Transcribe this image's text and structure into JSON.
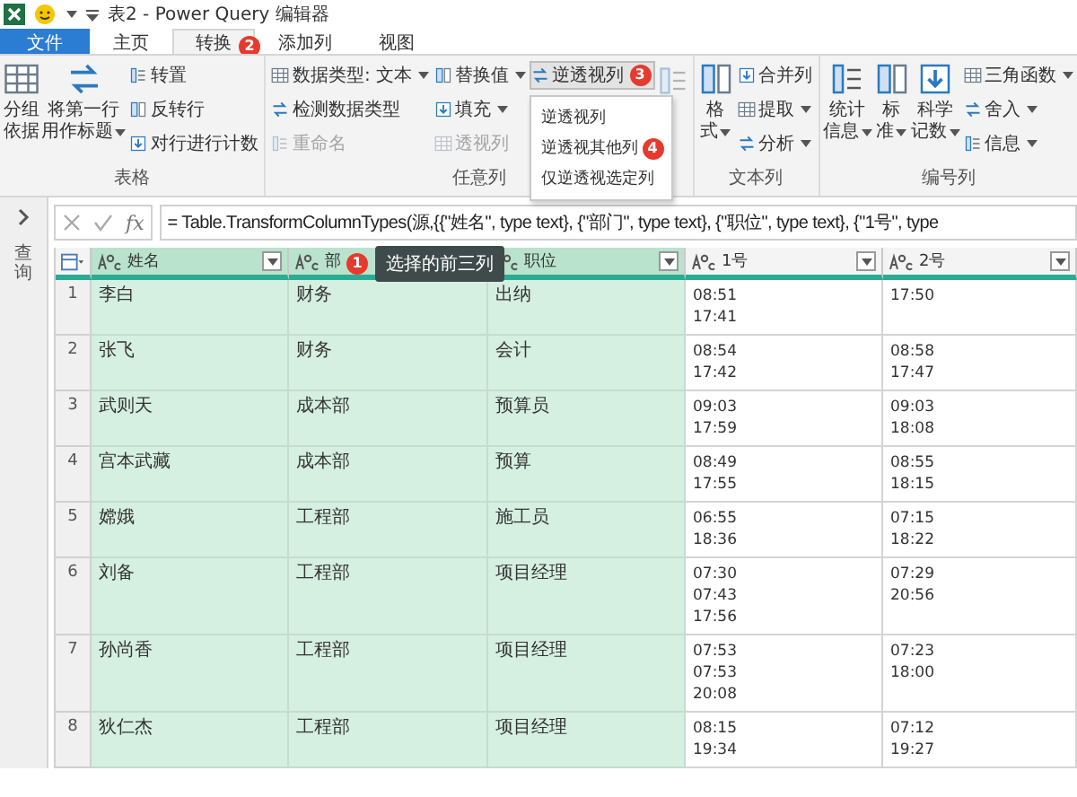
{
  "window": {
    "title": "表2 - Power Query 编辑器"
  },
  "tabs": [
    {
      "label": "文件",
      "kind": "file",
      "selected": false
    },
    {
      "label": "主页",
      "kind": "tab",
      "selected": false
    },
    {
      "label": "转换",
      "kind": "tab",
      "selected": true,
      "badge": "2"
    },
    {
      "label": "添加列",
      "kind": "tab",
      "selected": false
    },
    {
      "label": "视图",
      "kind": "tab",
      "selected": false
    }
  ],
  "ribbon": {
    "groups": [
      {
        "label": "表格",
        "columns": [
          {
            "kind": "large",
            "items": [
              {
                "label": "分组依据",
                "dropdown": false,
                "disabled": false
              }
            ]
          },
          {
            "kind": "large",
            "items": [
              {
                "label": "将第一行用作标题",
                "dropdown": true,
                "disabled": false
              }
            ]
          },
          {
            "kind": "stack",
            "items": [
              {
                "label": "转置",
                "dropdown": false,
                "disabled": false
              },
              {
                "label": "反转行",
                "dropdown": false,
                "disabled": false
              },
              {
                "label": "对行进行计数",
                "dropdown": false,
                "disabled": false
              }
            ]
          }
        ]
      },
      {
        "label": "任意列",
        "columns": [
          {
            "kind": "stack",
            "items": [
              {
                "label": "数据类型: 文本",
                "dropdown": true,
                "disabled": false
              },
              {
                "label": "检测数据类型",
                "dropdown": false,
                "disabled": false
              },
              {
                "label": "重命名",
                "dropdown": false,
                "disabled": true
              }
            ]
          },
          {
            "kind": "stack",
            "items": [
              {
                "label": "替换值",
                "dropdown": true,
                "disabled": false
              },
              {
                "label": "填充",
                "dropdown": true,
                "disabled": false
              },
              {
                "label": "透视列",
                "dropdown": false,
                "disabled": true
              }
            ]
          },
          {
            "kind": "stack",
            "items": [
              {
                "label": "逆透视列",
                "dropdown": false,
                "disabled": false,
                "open": true,
                "badge": "3",
                "menu": [
                  {
                    "label": "逆透视列"
                  },
                  {
                    "label": "逆透视其他列",
                    "badge": "4"
                  },
                  {
                    "label": "仅逆透视选定列"
                  }
                ]
              }
            ]
          },
          {
            "kind": "icon",
            "items": [
              {
                "disabled": true
              }
            ]
          }
        ]
      },
      {
        "label": "文本列",
        "columns": [
          {
            "kind": "large",
            "items": [
              {
                "label": "格式",
                "dropdown": true,
                "disabled": false
              }
            ]
          },
          {
            "kind": "stack",
            "items": [
              {
                "label": "合并列",
                "dropdown": false,
                "disabled": false
              },
              {
                "label": "提取",
                "dropdown": true,
                "disabled": false
              },
              {
                "label": "分析",
                "dropdown": true,
                "disabled": false
              }
            ]
          }
        ]
      },
      {
        "label": "编号列",
        "columns": [
          {
            "kind": "large",
            "items": [
              {
                "label": "统计信息",
                "dropdown": true,
                "disabled": false
              }
            ]
          },
          {
            "kind": "large",
            "items": [
              {
                "label": "标准",
                "dropdown": true,
                "disabled": false
              }
            ]
          },
          {
            "kind": "large",
            "items": [
              {
                "label": "科学记数",
                "dropdown": true,
                "disabled": false
              }
            ]
          },
          {
            "kind": "stack",
            "items": [
              {
                "label": "三角函数",
                "dropdown": true,
                "disabled": false
              },
              {
                "label": "舍入",
                "dropdown": true,
                "disabled": false
              },
              {
                "label": "信息",
                "dropdown": true,
                "disabled": false
              }
            ]
          }
        ]
      }
    ]
  },
  "query_pane": {
    "label": "查询"
  },
  "formula_bar": {
    "function_label": "fx",
    "text": "= Table.TransformColumnTypes(源,{{\"姓名\", type text}, {\"部门\", type text}, {\"职位\", type text}, {\"1号\", type"
  },
  "table": {
    "columns": [
      {
        "label": "姓名",
        "selected": true
      },
      {
        "label": "部",
        "selected": true,
        "tooltip": {
          "badge": "1",
          "text": "选择的前三列"
        }
      },
      {
        "label": "职位",
        "selected": true
      },
      {
        "label": "1号",
        "selected": false
      },
      {
        "label": "2号",
        "selected": false
      }
    ],
    "rows": [
      {
        "index": "1",
        "cells": [
          [
            "李白"
          ],
          [
            "财务"
          ],
          [
            "出纳"
          ],
          [
            "08:51",
            "17:41"
          ],
          [
            "17:50"
          ]
        ]
      },
      {
        "index": "2",
        "cells": [
          [
            "张飞"
          ],
          [
            "财务"
          ],
          [
            "会计"
          ],
          [
            "08:54",
            "17:42"
          ],
          [
            "08:58",
            "17:47"
          ]
        ]
      },
      {
        "index": "3",
        "cells": [
          [
            "武则天"
          ],
          [
            "成本部"
          ],
          [
            "预算员"
          ],
          [
            "09:03",
            "17:59"
          ],
          [
            "09:03",
            "18:08"
          ]
        ]
      },
      {
        "index": "4",
        "cells": [
          [
            "宫本武藏"
          ],
          [
            "成本部"
          ],
          [
            "预算"
          ],
          [
            "08:49",
            "17:55"
          ],
          [
            "08:55",
            "18:15"
          ]
        ]
      },
      {
        "index": "5",
        "cells": [
          [
            "嫦娥"
          ],
          [
            "工程部"
          ],
          [
            "施工员"
          ],
          [
            "06:55",
            "18:36"
          ],
          [
            "07:15",
            "18:22"
          ]
        ]
      },
      {
        "index": "6",
        "cells": [
          [
            "刘备"
          ],
          [
            "工程部"
          ],
          [
            "项目经理"
          ],
          [
            "07:30",
            "07:43",
            "17:56"
          ],
          [
            "07:29",
            "20:56"
          ]
        ]
      },
      {
        "index": "7",
        "cells": [
          [
            "孙尚香"
          ],
          [
            "工程部"
          ],
          [
            "项目经理"
          ],
          [
            "07:53",
            "07:53",
            "20:08"
          ],
          [
            "07:23",
            "18:00"
          ]
        ]
      },
      {
        "index": "8",
        "cells": [
          [
            "狄仁杰"
          ],
          [
            "工程部"
          ],
          [
            "项目经理"
          ],
          [
            "08:15",
            "19:34"
          ],
          [
            "07:12",
            "19:27"
          ]
        ]
      }
    ]
  }
}
